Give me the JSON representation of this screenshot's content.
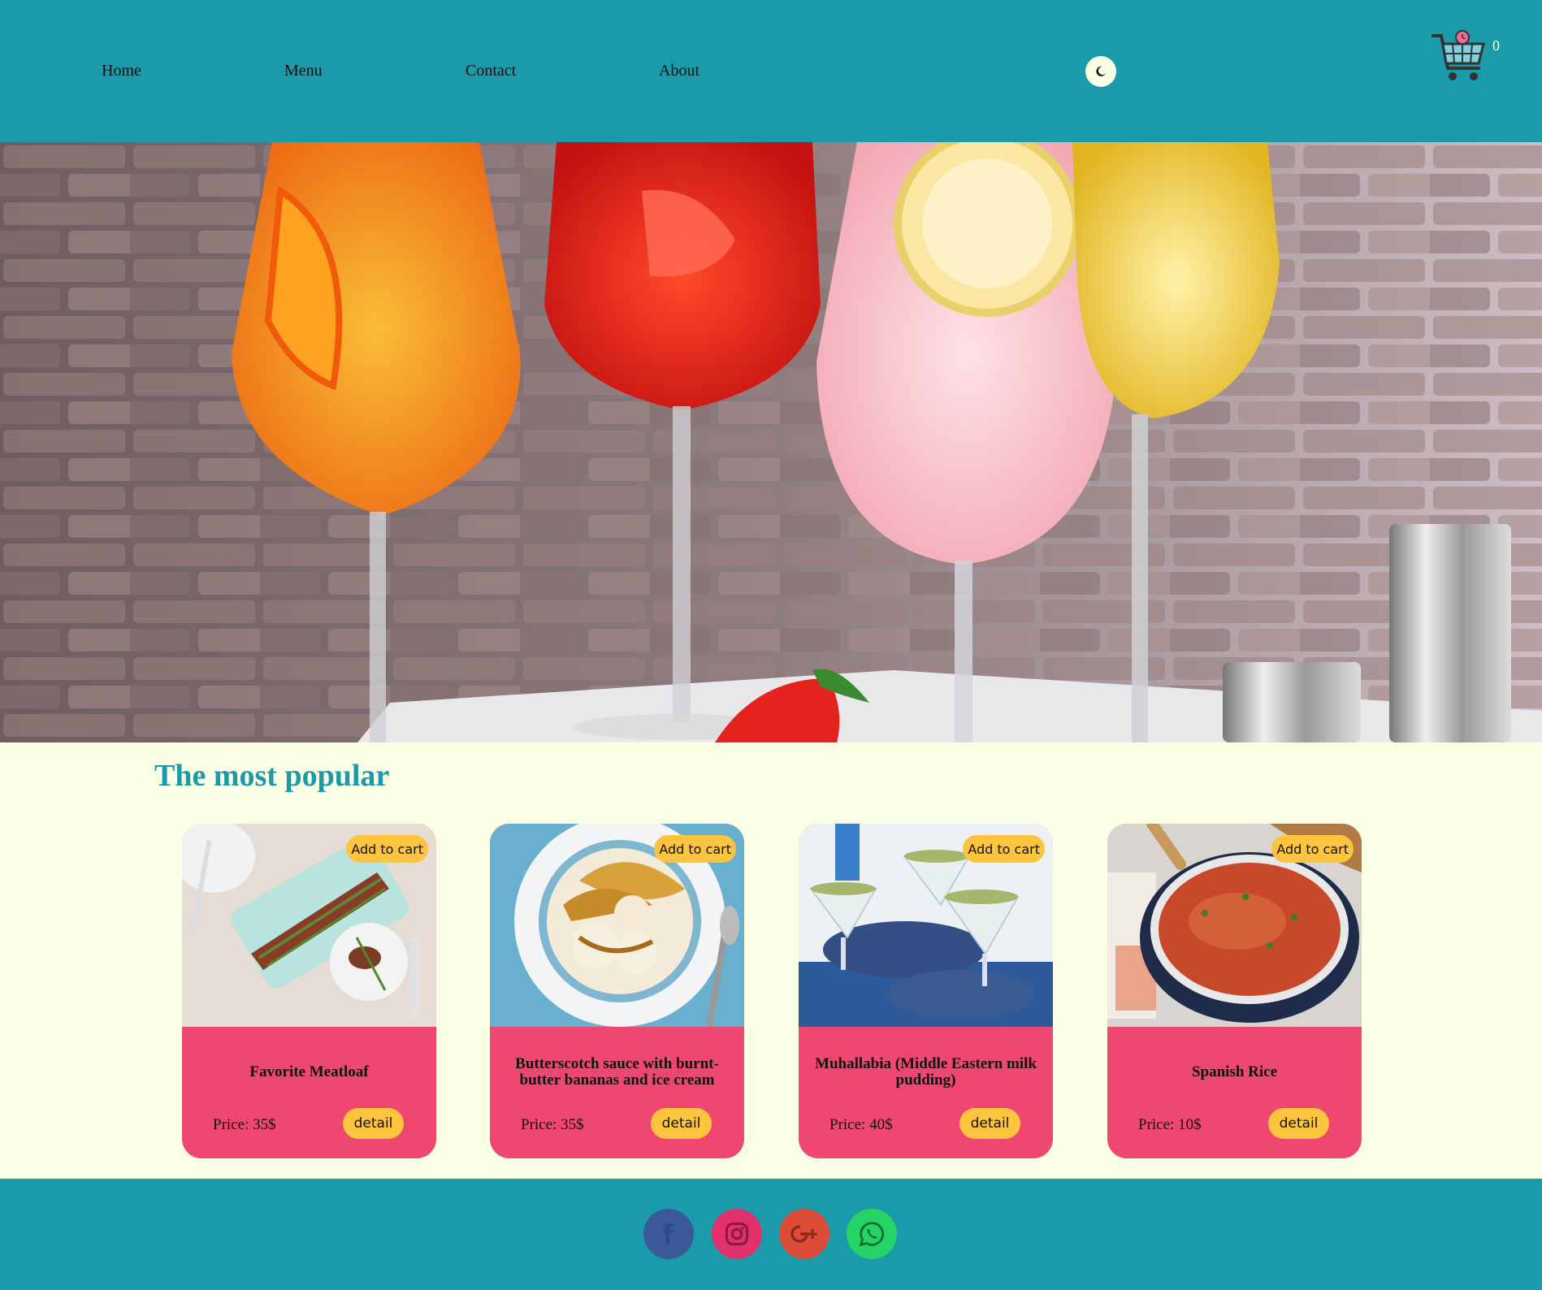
{
  "nav": {
    "home": "Home",
    "menu": "Menu",
    "contact": "Contact",
    "about": "About"
  },
  "header": {
    "theme_toggle_icon": "moon-icon",
    "cart_icon": "shopping-cart-icon",
    "cart_count": "0"
  },
  "hero": {
    "image": "cocktail-glasses-photo"
  },
  "popular": {
    "title": "The most popular",
    "items": [
      {
        "name": "Favorite Meatloaf",
        "price": "Price: 35$",
        "add_label": "Add to cart",
        "detail_label": "detail",
        "image": "meatloaf-photo"
      },
      {
        "name": "Butterscotch sauce with burnt-butter bananas and ice cream",
        "price": "Price: 35$",
        "add_label": "Add to cart",
        "detail_label": "detail",
        "image": "banana-ice-cream-photo"
      },
      {
        "name": "Muhallabia (Middle Eastern milk pudding)",
        "price": "Price: 40$",
        "add_label": "Add to cart",
        "detail_label": "detail",
        "image": "milk-pudding-photo"
      },
      {
        "name": "Spanish Rice",
        "price": "Price: 10$",
        "add_label": "Add to cart",
        "detail_label": "detail",
        "image": "spanish-rice-photo"
      }
    ]
  },
  "footer": {
    "social": [
      "facebook-icon",
      "instagram-icon",
      "google-plus-icon",
      "whatsapp-icon"
    ]
  },
  "colors": {
    "header_bg": "#1b9aaa",
    "page_bg": "#fbffe3",
    "card_bg": "#ef476f",
    "button_bg": "#ffc43d"
  }
}
